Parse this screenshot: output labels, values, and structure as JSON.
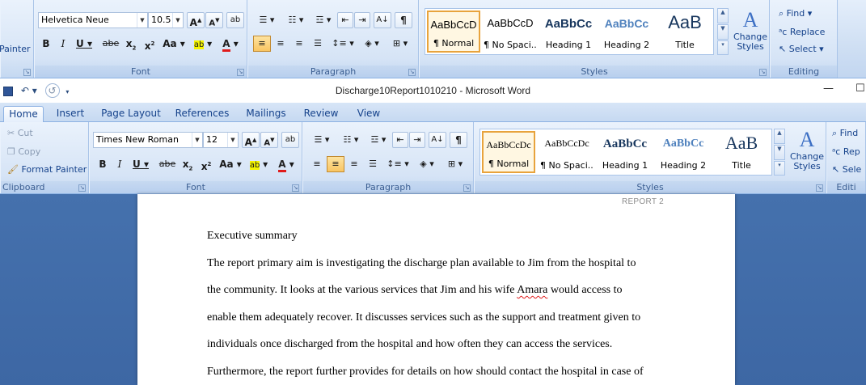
{
  "top_ribbon": {
    "clipboard": {
      "format_painter": "Painter"
    },
    "font": {
      "name": "Helvetica Neue",
      "size": "10.5",
      "label": "Font"
    },
    "paragraph": {
      "label": "Paragraph"
    },
    "styles": {
      "items": [
        {
          "sample": "AaBbCcD",
          "name": "¶ Normal"
        },
        {
          "sample": "AaBbCcD",
          "name": "¶ No Spaci..."
        },
        {
          "sample": "AaBbCc",
          "name": "Heading 1"
        },
        {
          "sample": "AaBbCc",
          "name": "Heading 2"
        },
        {
          "sample": "AaB",
          "name": "Title"
        }
      ],
      "change_styles": "Change Styles",
      "label": "Styles"
    },
    "editing": {
      "find": "Find",
      "replace": "Replace",
      "select": "Select",
      "label": "Editing"
    }
  },
  "titlebar": {
    "title": "Discharge10Report1010210 - Microsoft Word"
  },
  "tabs": [
    "Home",
    "Insert",
    "Page Layout",
    "References",
    "Mailings",
    "Review",
    "View"
  ],
  "ribbon": {
    "clipboard": {
      "cut": "Cut",
      "copy": "Copy",
      "format_painter": "Format Painter",
      "label": "Clipboard"
    },
    "font": {
      "name": "Times New Roman",
      "size": "12",
      "label": "Font"
    },
    "paragraph": {
      "label": "Paragraph"
    },
    "styles": {
      "items": [
        {
          "sample": "AaBbCcDc",
          "name": "¶ Normal"
        },
        {
          "sample": "AaBbCcDc",
          "name": "¶ No Spaci..."
        },
        {
          "sample": "AaBbCc",
          "name": "Heading 1"
        },
        {
          "sample": "AaBbCc",
          "name": "Heading 2"
        },
        {
          "sample": "AaB",
          "name": "Title"
        }
      ],
      "change_styles": "Change Styles",
      "label": "Styles"
    },
    "editing": {
      "find": "Find",
      "replace": "Rep",
      "select": "Sele",
      "label": "Editi"
    }
  },
  "document": {
    "header": "REPORT 2",
    "heading": "Executive summary",
    "lines": [
      "The report primary aim is investigating the discharge plan available to Jim from the hospital to",
      "the community. It looks at the various services that Jim and his wife ",
      "enable them adequately recover. It discusses services such as the support and treatment given to",
      "individuals once discharged from the hospital and how often they can access the services.",
      "Furthermore, the report further provides for details on how should contact the hospital in case of"
    ],
    "misspelled": "Amara",
    "line2_end": " would access to"
  },
  "colors": {
    "ribbon_bg": "#cfdff3",
    "accent": "#15428b",
    "doc_bg": "#3f6aa8",
    "highlight": "#f9c562"
  }
}
